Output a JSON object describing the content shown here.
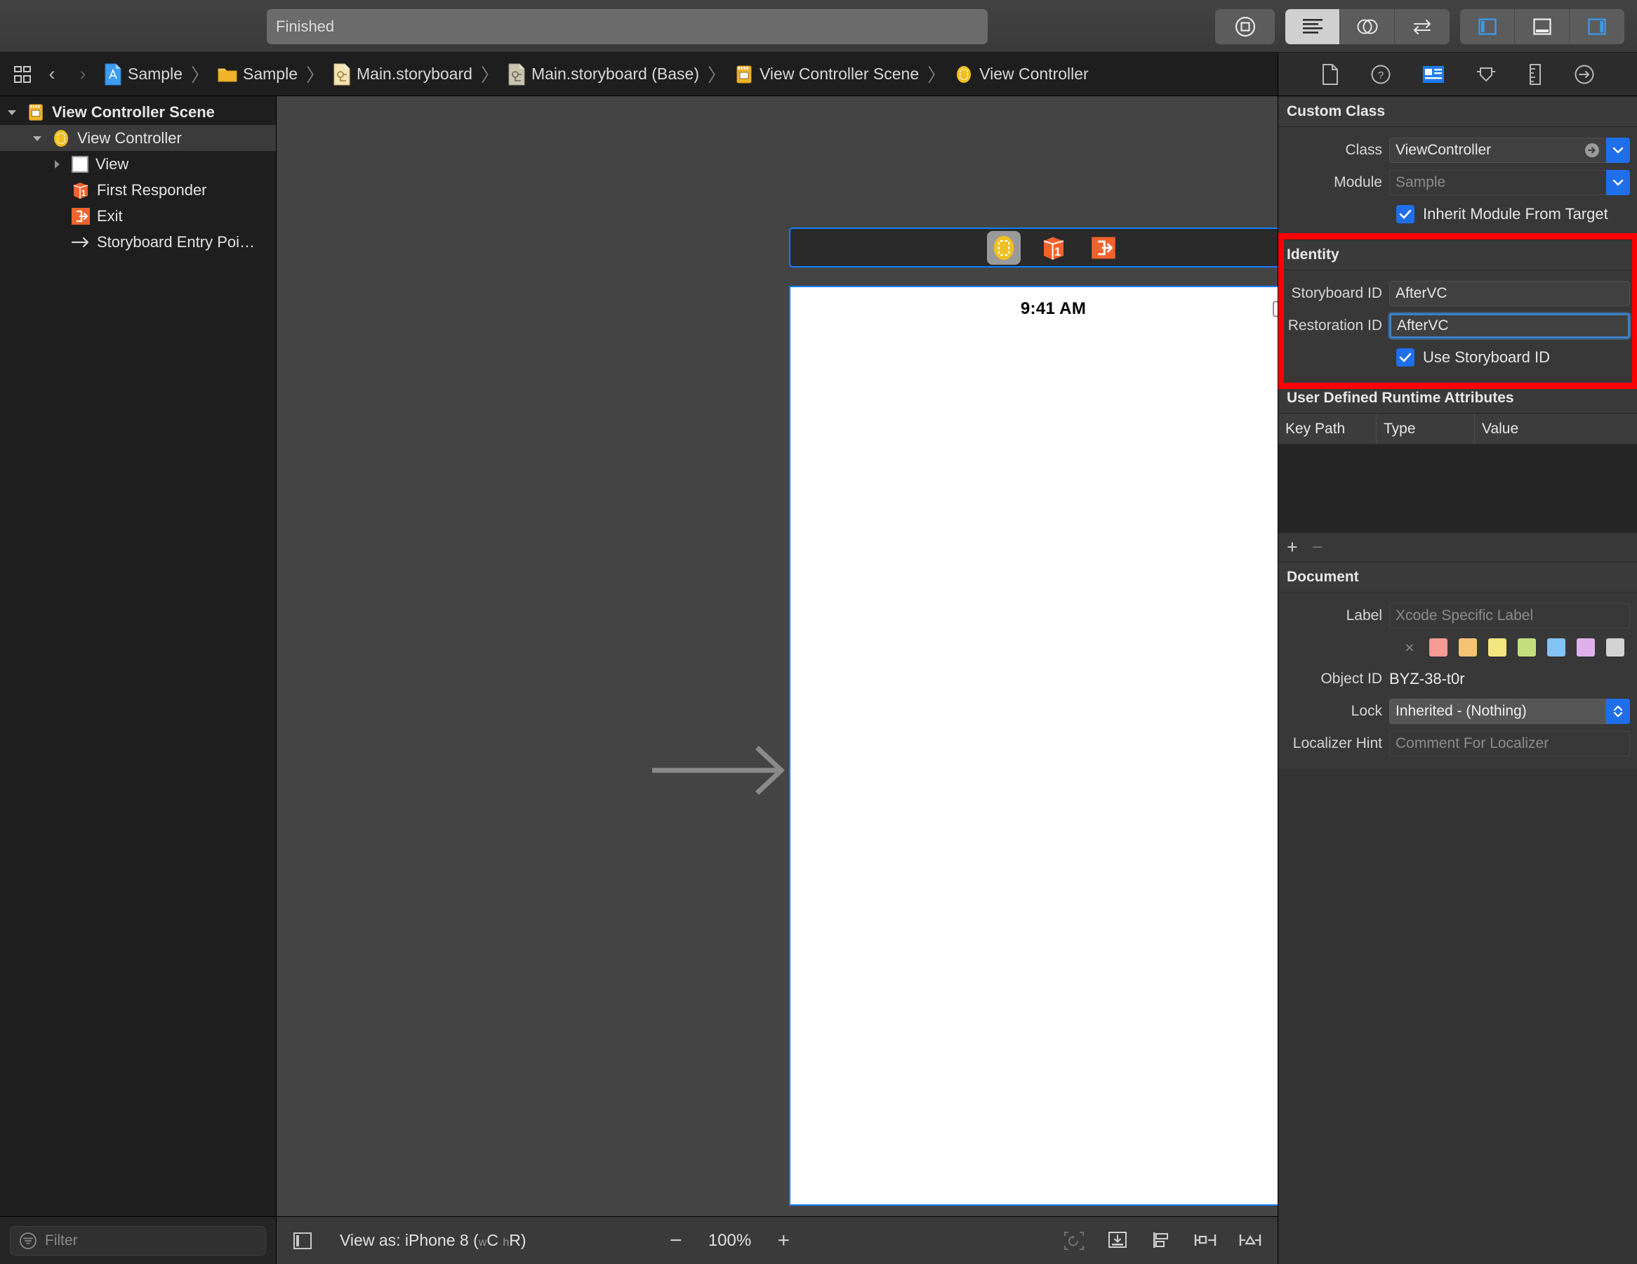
{
  "titlebar": {
    "status_text": "Finished",
    "buttons": [
      {
        "name": "stop-button",
        "icon": "stop-circle-icon"
      },
      {
        "name": "standard-editor-button",
        "icon": "lines-icon",
        "active": true
      },
      {
        "name": "assistant-editor-button",
        "icon": "venn-icon",
        "active": false
      },
      {
        "name": "version-editor-button",
        "icon": "swap-arrows-icon",
        "active": false
      },
      {
        "name": "toggle-navigator-button",
        "icon": "left-panel-icon"
      },
      {
        "name": "toggle-debug-area-button",
        "icon": "bottom-panel-icon"
      },
      {
        "name": "toggle-inspector-button",
        "icon": "right-panel-icon"
      }
    ]
  },
  "jumpbar": {
    "back_label": "‹",
    "forward_label": "›",
    "crumbs": [
      {
        "label": "Sample",
        "icon": "xcode-project-icon"
      },
      {
        "label": "Sample",
        "icon": "folder-icon"
      },
      {
        "label": "Main.storyboard",
        "icon": "storyboard-icon"
      },
      {
        "label": "Main.storyboard (Base)",
        "icon": "storyboard-base-icon"
      },
      {
        "label": "View Controller Scene",
        "icon": "scene-icon"
      },
      {
        "label": "View Controller",
        "icon": "view-controller-icon"
      }
    ],
    "separator": "〉"
  },
  "inspector_tabs": [
    {
      "name": "file-inspector-tab",
      "icon": "document-icon",
      "selected": false
    },
    {
      "name": "quick-help-inspector-tab",
      "icon": "question-circle-icon",
      "selected": false
    },
    {
      "name": "identity-inspector-tab",
      "icon": "identity-card-icon",
      "selected": true
    },
    {
      "name": "attributes-inspector-tab",
      "icon": "slider-shield-icon",
      "selected": false
    },
    {
      "name": "size-inspector-tab",
      "icon": "ruler-icon",
      "selected": false
    },
    {
      "name": "connections-inspector-tab",
      "icon": "arrow-circle-icon",
      "selected": false
    }
  ],
  "outline": {
    "items": [
      {
        "label": "View Controller Scene",
        "icon": "scene-icon",
        "disclosure": "open",
        "depth": 0,
        "selected": false,
        "bold": true
      },
      {
        "label": "View Controller",
        "icon": "view-controller-icon",
        "disclosure": "open",
        "depth": 1,
        "selected": true,
        "bold": false
      },
      {
        "label": "View",
        "icon": "view-square-icon",
        "disclosure": "closed",
        "depth": 2,
        "selected": false,
        "bold": false
      },
      {
        "label": "First Responder",
        "icon": "first-responder-cube-icon",
        "disclosure": "none",
        "depth": 2,
        "selected": false,
        "bold": false
      },
      {
        "label": "Exit",
        "icon": "exit-icon",
        "disclosure": "none",
        "depth": 2,
        "selected": false,
        "bold": false
      },
      {
        "label": "Storyboard Entry Poi…",
        "icon": "entry-point-arrow-icon",
        "disclosure": "none",
        "depth": 2,
        "selected": false,
        "bold": false
      }
    ],
    "filter_placeholder": "Filter"
  },
  "canvas": {
    "scene_bar_items": [
      {
        "name": "scene-view-controller-icon",
        "selected": true
      },
      {
        "name": "scene-first-responder-icon",
        "selected": false
      },
      {
        "name": "scene-exit-icon",
        "selected": false
      }
    ],
    "device_time": "9:41 AM"
  },
  "canvas_bar": {
    "view_as_prefix": "View as: iPhone 8 (",
    "view_as_w": "w",
    "view_as_wclass": "C",
    "view_as_h": "h",
    "view_as_hclass": "R",
    "view_as_suffix": ")",
    "zoom_out": "−",
    "zoom_level": "100%",
    "zoom_in": "+",
    "right_icons": [
      {
        "name": "update-frames-icon"
      },
      {
        "name": "embed-in-icon"
      },
      {
        "name": "align-icon"
      },
      {
        "name": "add-constraints-icon"
      },
      {
        "name": "resolve-issues-icon"
      }
    ]
  },
  "inspector": {
    "custom_class": {
      "title": "Custom Class",
      "class_label": "Class",
      "class_value": "ViewController",
      "module_label": "Module",
      "module_placeholder": "Sample",
      "inherit_label": "Inherit Module From Target",
      "inherit_checked": true
    },
    "identity": {
      "title": "Identity",
      "storyboard_id_label": "Storyboard ID",
      "storyboard_id_value": "AfterVC",
      "restoration_id_label": "Restoration ID",
      "restoration_id_value": "AfterVC",
      "use_storyboard_id_label": "Use Storyboard ID",
      "use_storyboard_id_checked": true,
      "highlight_color": "#ff0000"
    },
    "user_defined_runtime_attributes": {
      "title": "User Defined Runtime Attributes",
      "columns": [
        "Key Path",
        "Type",
        "Value"
      ],
      "rows": [],
      "add_label": "+",
      "remove_label": "−"
    },
    "document": {
      "title": "Document",
      "label_label": "Label",
      "label_placeholder": "Xcode Specific Label",
      "swatch_none": "×",
      "swatches": [
        "#f89b94",
        "#f6c275",
        "#f3e67f",
        "#c3dd7f",
        "#83c3f5",
        "#dfb1ec",
        "#d3d3d3"
      ],
      "object_id_label": "Object ID",
      "object_id_value": "BYZ-38-t0r",
      "lock_label": "Lock",
      "lock_value": "Inherited - (Nothing)",
      "localizer_hint_label": "Localizer Hint",
      "localizer_hint_placeholder": "Comment For Localizer"
    }
  }
}
